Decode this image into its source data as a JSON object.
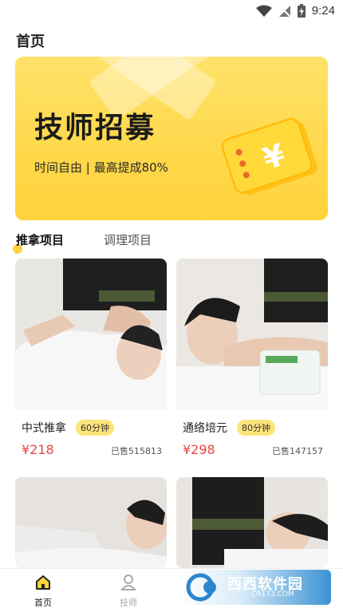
{
  "status": {
    "time": "9:24"
  },
  "page": {
    "title": "首页"
  },
  "banner": {
    "title": "技师招募",
    "subtitle": "时间自由 | 最高提成80%",
    "coupon_symbol": "¥"
  },
  "tabs": [
    {
      "label": "推拿项目",
      "active": true
    },
    {
      "label": "调理项目",
      "active": false
    }
  ],
  "cards": [
    {
      "name": "中式推拿",
      "duration": "60分钟",
      "price": "¥218",
      "sold": "已售515813"
    },
    {
      "name": "通络培元",
      "duration": "80分钟",
      "price": "¥298",
      "sold": "已售147157"
    },
    {
      "name": "",
      "duration": "",
      "price": "",
      "sold": ""
    },
    {
      "name": "",
      "duration": "",
      "price": "",
      "sold": ""
    }
  ],
  "nav": [
    {
      "label": "首页",
      "icon": "home-icon",
      "active": true
    },
    {
      "label": "技师",
      "icon": "person-icon",
      "active": false
    }
  ],
  "watermark": {
    "text": "西西软件园",
    "sub": "CR173.COM"
  },
  "colors": {
    "accent": "#ffd84a",
    "price": "#e64545",
    "badge": "#ffe37a"
  }
}
